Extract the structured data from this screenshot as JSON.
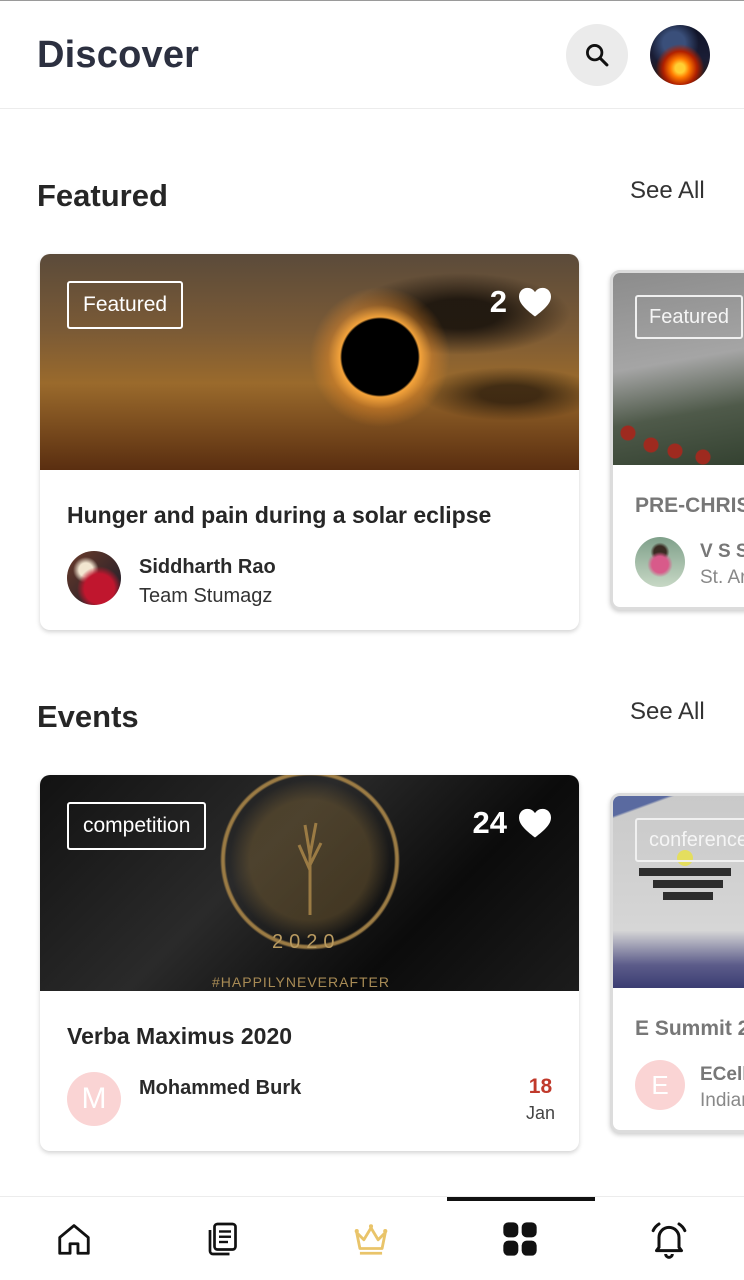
{
  "header": {
    "title": "Discover"
  },
  "featured": {
    "section_title": "Featured",
    "see_all_label": "See All",
    "cards": [
      {
        "tag": "Featured",
        "likes": "2",
        "title": "Hunger and pain during a solar eclipse",
        "author": "Siddharth Rao",
        "team": "Team Stumagz"
      },
      {
        "tag": "Featured",
        "title": "PRE-CHRIS",
        "author": "V S S",
        "team": "St. Ar"
      }
    ]
  },
  "events": {
    "section_title": "Events",
    "see_all_label": "See All",
    "cards": [
      {
        "tag": "competition",
        "likes": "24",
        "title": "Verba Maximus 2020",
        "author": "Mohammed Burk",
        "author_initial": "M",
        "image_year": "2020",
        "image_hashtag": "#HAPPILYNEVERAFTER",
        "date_day": "18",
        "date_month": "Jan"
      },
      {
        "tag": "conference",
        "title": "E Summit 2",
        "author": "ECell",
        "team": "Indiar",
        "author_initial": "E"
      }
    ]
  },
  "bottom_nav": {
    "items": [
      "home",
      "articles",
      "premium",
      "discover",
      "notifications"
    ],
    "active": "discover",
    "premium_color": "#e9c46a"
  },
  "colors": {
    "title": "#2c3040",
    "date_day": "#c0392b",
    "avatar_letter_bg": "#fad4d4"
  }
}
